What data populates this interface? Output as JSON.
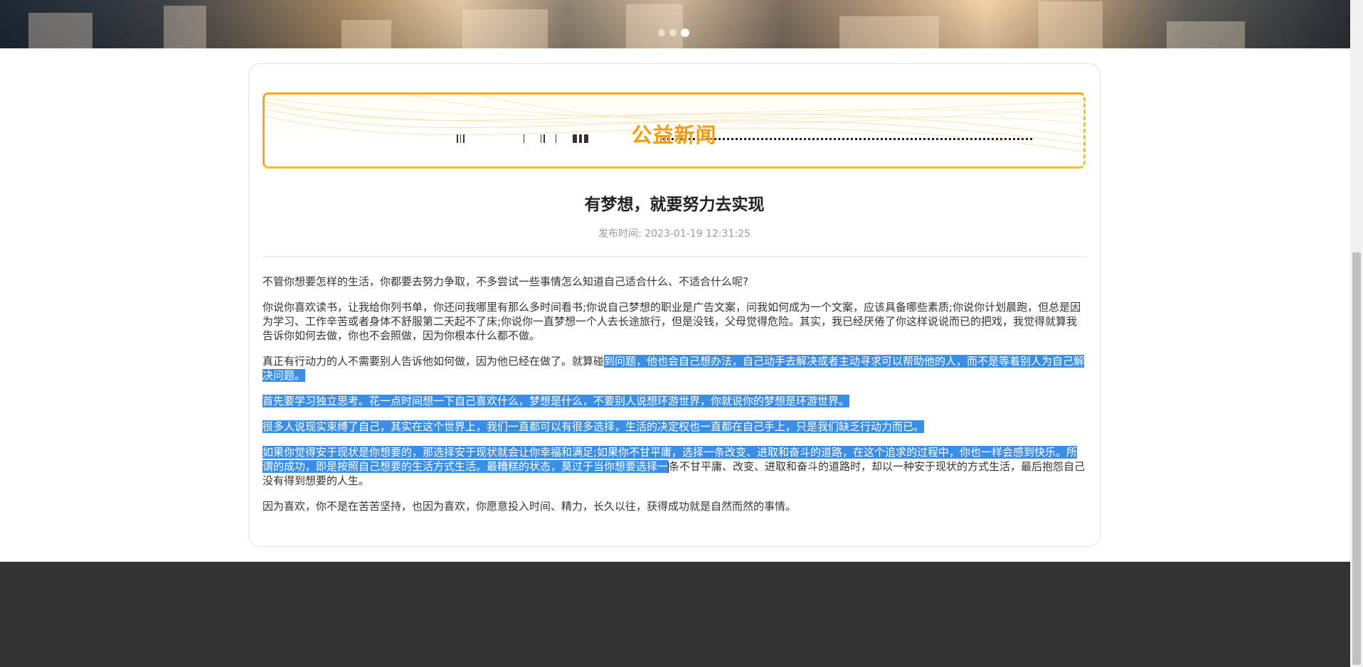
{
  "hero": {
    "carousel_count": 3,
    "carousel_active": 3
  },
  "banner": {
    "title": "公益新闻"
  },
  "article": {
    "title": "有梦想，就要努力去实现",
    "publish_label": "发布时间:",
    "publish_time": "2023-01-19 12:31:25",
    "paragraphs": [
      "不管你想要怎样的生活，你都要去努力争取，不多尝试一些事情怎么知道自己适合什么、不适合什么呢?",
      "你说你喜欢读书，让我给你列书单，你还问我哪里有那么多时间看书;你说自己梦想的职业是广告文案，问我如何成为一个文案，应该具备哪些素质;你说你计划晨跑，但总是因为学习、工作辛苦或者身体不舒服第二天起不了床;你说你一直梦想一个人去长途旅行，但是没钱，父母觉得危险。其实，我已经厌倦了你这样说说而已的把戏，我觉得就算我告诉你如何去做，你也不会照做，因为你根本什么都不做。",
      {
        "plain": "真正有行动力的人不需要别人告诉他如何做，因为他已经在做了。就算碰",
        "selected": "到问题，他也会自己想办法，自己动手去解决或者主动寻求可以帮助他的人，而不是等着别人为自己解决问题。"
      },
      "首先要学习独立思考。花一点时间想一下自己喜欢什么，梦想是什么，不要别人说想环游世界，你就说你的梦想是环游世界。",
      "很多人说现实束缚了自己，其实在这个世界上，我们一直都可以有很多选择，生活的决定权也一直都在自己手上，只是我们缺乏行动力而已。",
      {
        "selected": "如果你觉得安于现状是你想要的，那选择安于现状就会让你幸福和满足;如果你不甘平庸，选择一条改变、进取和奋斗的道路，在这个追求的过程中，你也一样会感到快乐。所谓的成功，即是按照自己想要的生活方式生活。最糟糕的状态，莫过于当你想要选择一",
        "plain": "条不甘平庸、改变、进取和奋斗的道路时，却以一种安于现状的方式生活，最后抱怨自己没有得到想要的人生。"
      },
      "因为喜欢，你不是在苦苦坚持，也因为喜欢，你愿意投入时间、精力，长久以往，获得成功就是自然而然的事情。"
    ]
  },
  "colors": {
    "selection": "#3a8ee6",
    "banner_title": "#f39c12",
    "footer": "#333333"
  }
}
